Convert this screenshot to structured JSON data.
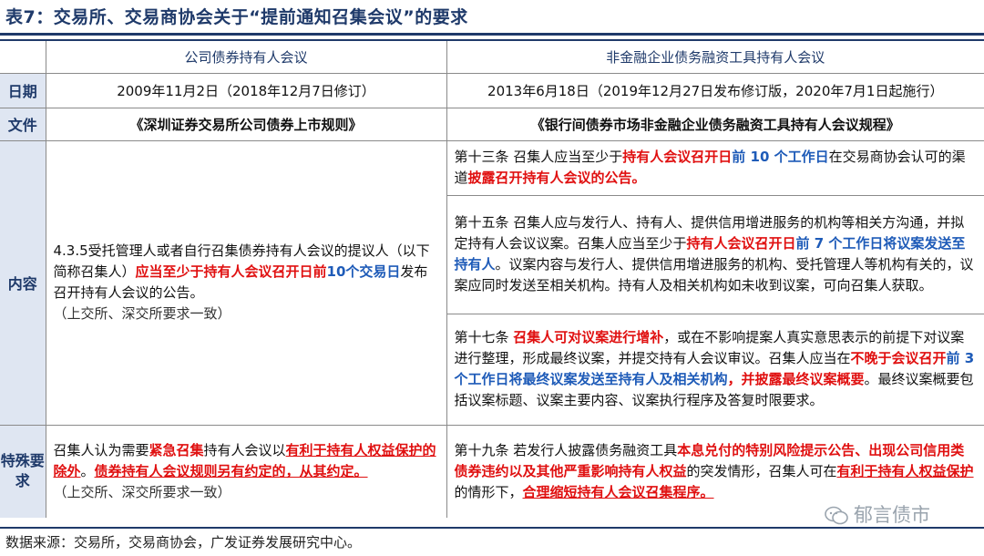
{
  "title": "表7：交易所、交易商协会关于“提前通知召集会议”的要求",
  "columns": [
    "公司债券持有人会议",
    "非金融企业债务融资工具持有人会议"
  ],
  "rows": {
    "date": {
      "label": "日期",
      "left": "2009年11月2日（2018年12月7日修订）",
      "right": "2013年6月18日（2019年12月27日发布修订版，2020年7月1日起施行）"
    },
    "file": {
      "label": "文件",
      "left": "《深圳证券交易所公司债券上市规则》",
      "right": "《银行间债券市场非金融企业债务融资工具持有人会议规程》"
    },
    "content": {
      "label": "内容",
      "left": {
        "p1": "4.3.5受托管理人或者自行召集债券持有人会议的提议人（以下简称召集人）",
        "p2": "应当至少于持有人会议召开日前",
        "p3": "10个交易日",
        "p4": "发布召开持有人会议的公告。",
        "note": "（上交所、深交所要求一致）"
      },
      "right_1": {
        "a": "第十三条 召集人应当至少于",
        "b": "持有人会议召开日",
        "c": "前 10 个工作日",
        "d": "在交易商协会认可的渠道",
        "e": "披露召开持有人会议的公告。"
      },
      "right_2": {
        "a": "第十五条 召集人应与发行人、持有人、提供信用增进服务的机构等相关方沟通，并拟定持有人会议议案。召集人应当至少于",
        "b": "持有人会议召开日",
        "c": "前 7 个工作日将议案发送至持有人",
        "d": "。议案内容与发行人、提供信用增进服务的机构、受托管理人等机构有关的，议案应同时发送至相关机构。持有人及相关机构如未收到议案，可向召集人获取。"
      },
      "right_3": {
        "a": "第十七条 ",
        "b": "召集人可对议案进行增补",
        "c": "，或在不影响提案人真实意思表示的前提下对议案进行整理，形成最终议案，并提交持有人会议审议。召集人应当在",
        "d": "不晚于会议召开",
        "e": "前 3 个工作日将最终议案发送至持有人及相关机构",
        "f": "，并披露最终议案概要",
        "g": "。最终议案概要包括议案标题、议案主要内容、议案执行程序及答复时限要求。"
      }
    },
    "special": {
      "label": "特殊要求",
      "left": {
        "a": "召集人认为需要",
        "b": "紧急召集",
        "c": "持有人会议以",
        "d": "有利于持有人权益保护的除外",
        "e": "。",
        "f": "债券持有人会议规则另有约定的，从其约定。",
        "note": "（上交所、深交所要求一致）"
      },
      "right": {
        "a": "第十九条 若发行人披露债务融资工具",
        "b": "本息兑付的特别风险提示公告、出现公司信用类债券违约以及其他严重影响持有人权益",
        "c": "的突发情形，召集人可在",
        "d": "有利于持有人权益保护",
        "e": "的情形下，",
        "f": "合理缩短持有人会议召集程序。"
      }
    }
  },
  "source": "数据来源：交易所，交易商协会，广发证券发展研究中心。",
  "watermark": "郁言债市",
  "colors": {
    "accent": "#1f3a6a",
    "label_bg": "#dfe6f2",
    "red": "#e01010",
    "blue": "#1e5bb8"
  }
}
